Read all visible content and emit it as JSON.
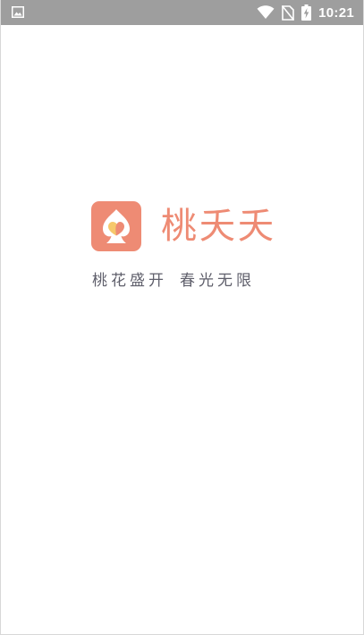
{
  "status_bar": {
    "time": "10:21",
    "icons": [
      "image-icon",
      "wifi-icon",
      "no-sim-icon",
      "battery-charging-icon"
    ]
  },
  "splash": {
    "app_name": "桃夭夭",
    "slogan_part1": "桃花盛开",
    "slogan_part2": "春光无限",
    "logo_icon": "spade-heart-logo-icon"
  },
  "colors": {
    "status_bar_bg": "#9e9e9e",
    "brand": "#ee8b74",
    "slogan_text": "#5f5f6b",
    "background": "#ffffff"
  }
}
